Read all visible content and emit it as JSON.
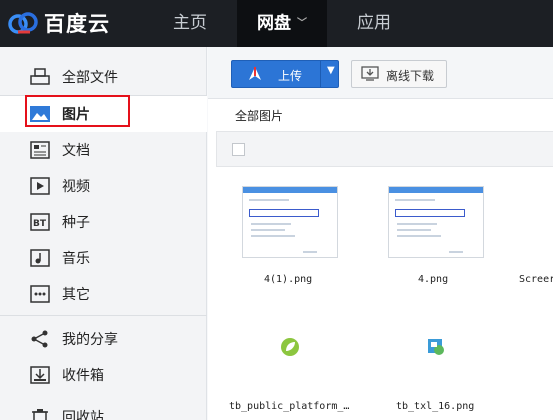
{
  "app": {
    "logo_text": "百度云"
  },
  "nav": {
    "home": "主页",
    "disk": "网盘",
    "apps": "应用"
  },
  "sidebar": {
    "items": [
      {
        "label": "全部文件",
        "icon": "printer-icon"
      },
      {
        "label": "图片",
        "icon": "image-icon"
      },
      {
        "label": "文档",
        "icon": "document-icon"
      },
      {
        "label": "视频",
        "icon": "video-icon"
      },
      {
        "label": "种子",
        "icon": "bt-icon"
      },
      {
        "label": "音乐",
        "icon": "music-icon"
      },
      {
        "label": "其它",
        "icon": "more-icon"
      },
      {
        "label": "我的分享",
        "icon": "share-icon"
      },
      {
        "label": "收件箱",
        "icon": "inbox-icon"
      },
      {
        "label": "回收站",
        "icon": "trash-icon"
      }
    ],
    "selected": "图片"
  },
  "toolbar": {
    "upload_label": "上传",
    "offline_label": "离线下载"
  },
  "breadcrumb": "全部图片",
  "files": [
    {
      "name": "4(1).png"
    },
    {
      "name": "4.png"
    },
    {
      "name": "Screer"
    },
    {
      "name": "tb_public_platform_…"
    },
    {
      "name": "tb_txl_16.png"
    }
  ],
  "colors": {
    "topbar": "#1c1f24",
    "accent": "#2c75d6",
    "highlight": "#e5101a"
  }
}
